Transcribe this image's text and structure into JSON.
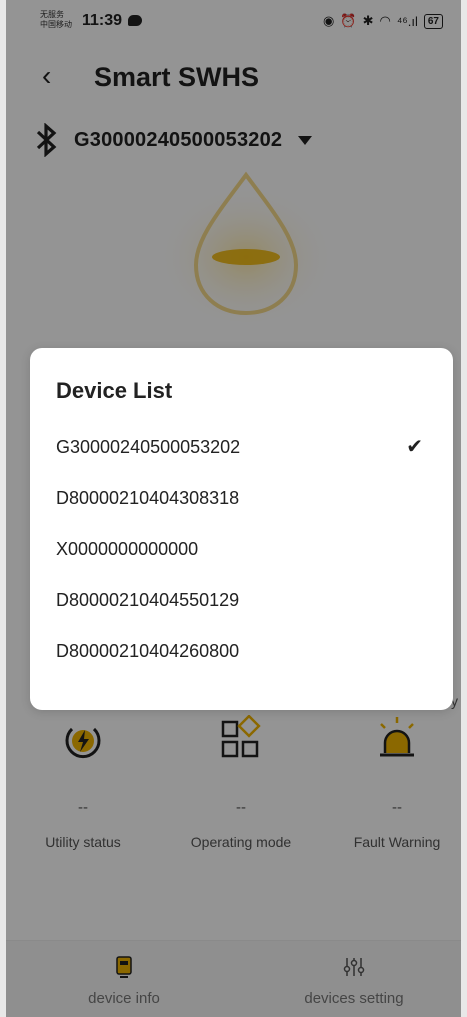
{
  "status_bar": {
    "carrier_line1": "无服务",
    "carrier_line2": "中国移动",
    "time": "11:39",
    "network": "⁴⁶.ıl",
    "battery": "67"
  },
  "header": {
    "title": "Smart SWHS"
  },
  "selected_device": {
    "id": "G30000240500053202"
  },
  "background": {
    "cutoff_text": "y"
  },
  "status_cards": [
    {
      "value": "--",
      "label": "Utility status",
      "icon": "lightning-power-icon"
    },
    {
      "value": "--",
      "label": "Operating mode",
      "icon": "mode-grid-icon"
    },
    {
      "value": "--",
      "label": "Fault Warning",
      "icon": "alarm-light-icon"
    }
  ],
  "bottom_nav": [
    {
      "label": "device info",
      "icon": "device-icon",
      "active": true
    },
    {
      "label": "devices setting",
      "icon": "sliders-icon",
      "active": false
    }
  ],
  "dialog": {
    "title": "Device List",
    "items": [
      {
        "id": "G30000240500053202",
        "selected": true
      },
      {
        "id": "D80000210404308318",
        "selected": false
      },
      {
        "id": "X0000000000000",
        "selected": false
      },
      {
        "id": "D80000210404550129",
        "selected": false
      },
      {
        "id": "D80000210404260800",
        "selected": false
      }
    ],
    "check_glyph": "✔"
  },
  "colors": {
    "accent": "#f0b400",
    "overlay": "rgba(0,0,0,0.42)"
  }
}
